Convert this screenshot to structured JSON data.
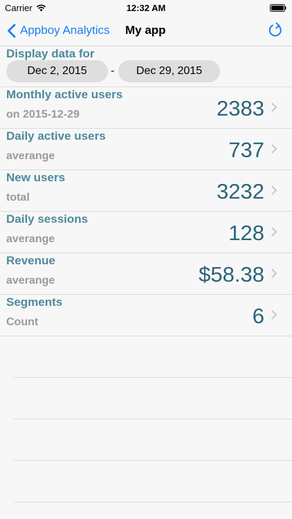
{
  "status_bar": {
    "carrier": "Carrier",
    "time": "12:32 AM"
  },
  "nav": {
    "back_label": "Appboy Analytics",
    "title": "My app"
  },
  "date_range": {
    "label": "Display data for",
    "start": "Dec 2, 2015",
    "separator": "-",
    "end": "Dec 29, 2015"
  },
  "metrics": [
    {
      "title": "Monthly active users",
      "subtitle": "on 2015-12-29",
      "value": "2383"
    },
    {
      "title": "Daily active users",
      "subtitle": "averange",
      "value": "737"
    },
    {
      "title": "New users",
      "subtitle": "total",
      "value": "3232"
    },
    {
      "title": "Daily sessions",
      "subtitle": "averange",
      "value": "128"
    },
    {
      "title": "Revenue",
      "subtitle": "averange",
      "value": "$58.38"
    },
    {
      "title": "Segments",
      "subtitle": "Count",
      "value": "6"
    }
  ],
  "colors": {
    "accent": "#1a7ef5",
    "label": "#4d8a9b",
    "value": "#2c6478",
    "subtitle": "#9a9a9a"
  }
}
